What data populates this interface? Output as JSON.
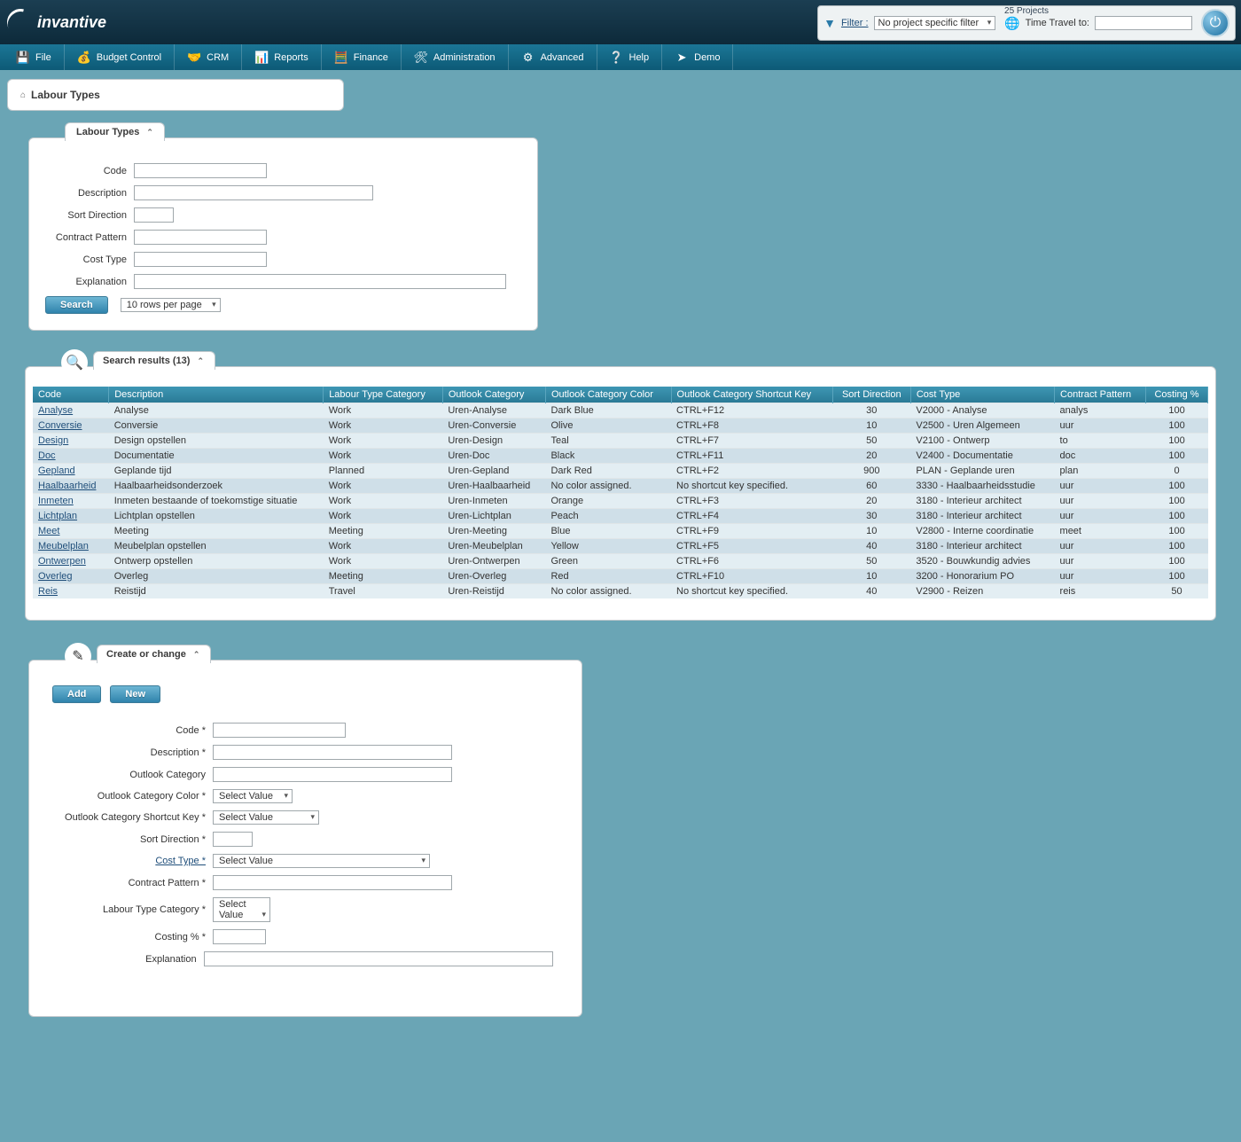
{
  "brand": "invantive",
  "header": {
    "projects_label": "25 Projects",
    "filter_label": "Filter :",
    "filter_value": "No project specific filter",
    "time_travel_label": "Time Travel to:",
    "time_travel_value": ""
  },
  "menu": {
    "file": "File",
    "budget": "Budget Control",
    "crm": "CRM",
    "reports": "Reports",
    "finance": "Finance",
    "admin": "Administration",
    "advanced": "Advanced",
    "help": "Help",
    "demo": "Demo"
  },
  "breadcrumb": {
    "title": "Labour Types"
  },
  "search_panel": {
    "tab": "Labour Types",
    "labels": {
      "code": "Code",
      "description": "Description",
      "sort": "Sort Direction",
      "contract": "Contract Pattern",
      "cost": "Cost Type",
      "explanation": "Explanation"
    },
    "search_btn": "Search",
    "rows_per_page": "10 rows per page"
  },
  "results": {
    "tab": "Search results (13)",
    "columns": {
      "code": "Code",
      "description": "Description",
      "category": "Labour Type Category",
      "outlook_cat": "Outlook Category",
      "outlook_color": "Outlook Category Color",
      "outlook_shortcut": "Outlook Category Shortcut Key",
      "sort": "Sort Direction",
      "cost": "Cost Type",
      "contract": "Contract Pattern",
      "costing": "Costing %"
    },
    "rows": [
      {
        "code": "Analyse",
        "description": "Analyse",
        "category": "Work",
        "outlook_cat": "Uren-Analyse",
        "outlook_color": "Dark Blue",
        "outlook_shortcut": "CTRL+F12",
        "sort": "30",
        "cost": "V2000 - Analyse",
        "contract": "analys",
        "costing": "100"
      },
      {
        "code": "Conversie",
        "description": "Conversie",
        "category": "Work",
        "outlook_cat": "Uren-Conversie",
        "outlook_color": "Olive",
        "outlook_shortcut": "CTRL+F8",
        "sort": "10",
        "cost": "V2500 - Uren Algemeen",
        "contract": "uur",
        "costing": "100"
      },
      {
        "code": "Design",
        "description": "Design opstellen",
        "category": "Work",
        "outlook_cat": "Uren-Design",
        "outlook_color": "Teal",
        "outlook_shortcut": "CTRL+F7",
        "sort": "50",
        "cost": "V2100 - Ontwerp",
        "contract": "to",
        "costing": "100"
      },
      {
        "code": "Doc",
        "description": "Documentatie",
        "category": "Work",
        "outlook_cat": "Uren-Doc",
        "outlook_color": "Black",
        "outlook_shortcut": "CTRL+F11",
        "sort": "20",
        "cost": "V2400 - Documentatie",
        "contract": "doc",
        "costing": "100"
      },
      {
        "code": "Gepland",
        "description": "Geplande tijd",
        "category": "Planned",
        "outlook_cat": "Uren-Gepland",
        "outlook_color": "Dark Red",
        "outlook_shortcut": "CTRL+F2",
        "sort": "900",
        "cost": "PLAN - Geplande uren",
        "contract": "plan",
        "costing": "0"
      },
      {
        "code": "Haalbaarheid",
        "description": "Haalbaarheidsonderzoek",
        "category": "Work",
        "outlook_cat": "Uren-Haalbaarheid",
        "outlook_color": "No color assigned.",
        "outlook_shortcut": "No shortcut key specified.",
        "sort": "60",
        "cost": "3330 - Haalbaarheidsstudie",
        "contract": "uur",
        "costing": "100"
      },
      {
        "code": "Inmeten",
        "description": "Inmeten bestaande of toekomstige situatie",
        "category": "Work",
        "outlook_cat": "Uren-Inmeten",
        "outlook_color": "Orange",
        "outlook_shortcut": "CTRL+F3",
        "sort": "20",
        "cost": "3180 - Interieur architect",
        "contract": "uur",
        "costing": "100"
      },
      {
        "code": "Lichtplan",
        "description": "Lichtplan opstellen",
        "category": "Work",
        "outlook_cat": "Uren-Lichtplan",
        "outlook_color": "Peach",
        "outlook_shortcut": "CTRL+F4",
        "sort": "30",
        "cost": "3180 - Interieur architect",
        "contract": "uur",
        "costing": "100"
      },
      {
        "code": "Meet",
        "description": "Meeting",
        "category": "Meeting",
        "outlook_cat": "Uren-Meeting",
        "outlook_color": "Blue",
        "outlook_shortcut": "CTRL+F9",
        "sort": "10",
        "cost": "V2800 - Interne coordinatie",
        "contract": "meet",
        "costing": "100"
      },
      {
        "code": "Meubelplan",
        "description": "Meubelplan opstellen",
        "category": "Work",
        "outlook_cat": "Uren-Meubelplan",
        "outlook_color": "Yellow",
        "outlook_shortcut": "CTRL+F5",
        "sort": "40",
        "cost": "3180 - Interieur architect",
        "contract": "uur",
        "costing": "100"
      },
      {
        "code": "Ontwerpen",
        "description": "Ontwerp opstellen",
        "category": "Work",
        "outlook_cat": "Uren-Ontwerpen",
        "outlook_color": "Green",
        "outlook_shortcut": "CTRL+F6",
        "sort": "50",
        "cost": "3520 - Bouwkundig advies",
        "contract": "uur",
        "costing": "100"
      },
      {
        "code": "Overleg",
        "description": "Overleg",
        "category": "Meeting",
        "outlook_cat": "Uren-Overleg",
        "outlook_color": "Red",
        "outlook_shortcut": "CTRL+F10",
        "sort": "10",
        "cost": "3200 - Honorarium PO",
        "contract": "uur",
        "costing": "100"
      },
      {
        "code": "Reis",
        "description": "Reistijd",
        "category": "Travel",
        "outlook_cat": "Uren-Reistijd",
        "outlook_color": "No color assigned.",
        "outlook_shortcut": "No shortcut key specified.",
        "sort": "40",
        "cost": "V2900 - Reizen",
        "contract": "reis",
        "costing": "50"
      }
    ]
  },
  "create": {
    "tab": "Create or change",
    "add_btn": "Add",
    "new_btn": "New",
    "labels": {
      "code": "Code *",
      "description": "Description *",
      "outlook_cat": "Outlook Category",
      "outlook_color": "Outlook Category Color *",
      "outlook_shortcut": "Outlook Category Shortcut Key *",
      "sort": "Sort Direction *",
      "cost": "Cost Type *",
      "contract": "Contract Pattern *",
      "category": "Labour Type Category *",
      "costing": "Costing % *",
      "explanation": "Explanation"
    },
    "select_value": "Select Value"
  }
}
